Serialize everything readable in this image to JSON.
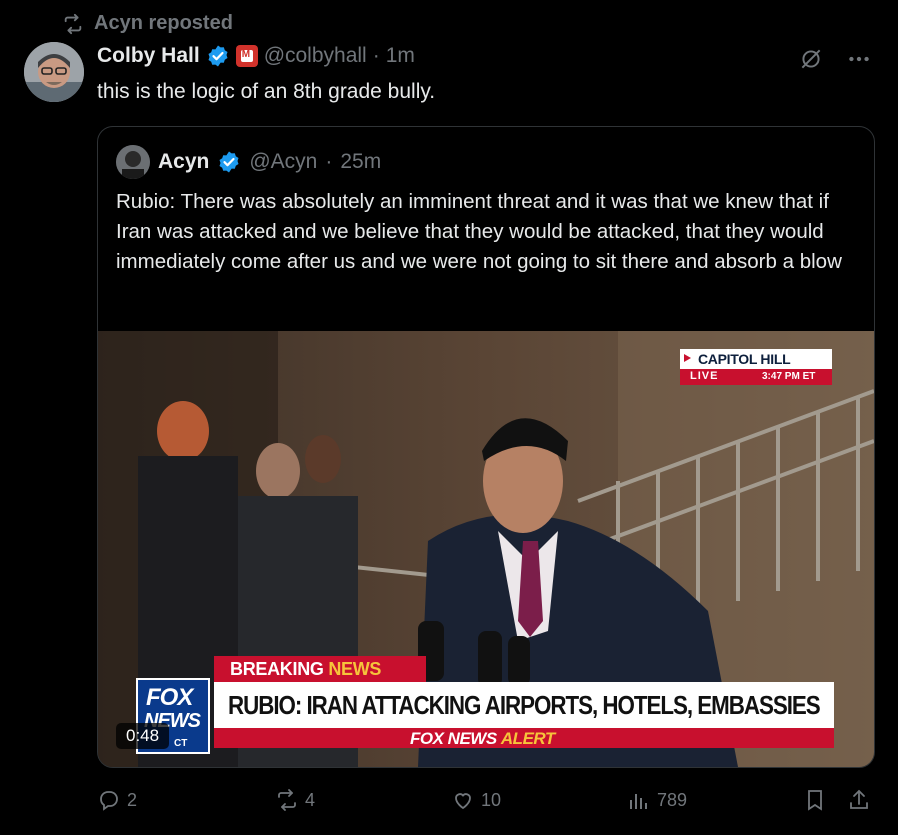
{
  "repost": {
    "label": "Acyn reposted",
    "icon": "repost-icon"
  },
  "tweet": {
    "author_name": "Colby Hall",
    "handle": "@colbyhall",
    "time": "1m",
    "text": "this is the logic of an 8th grade bully."
  },
  "quote": {
    "author_name": "Acyn",
    "handle": "@Acyn",
    "time": "25m",
    "text": "Rubio: There was absolutely an imminent threat and it was that we knew that if Iran was attacked and we believe that they would be attacked, that they would immediately come after us and we were not going to sit there and absorb a blow"
  },
  "video": {
    "bug_location": "CAPITOL HILL",
    "bug_live": "LIVE",
    "bug_time": "3:47 PM ET",
    "breaking_1": "BREAKING",
    "breaking_2": "NEWS",
    "headline": "RUBIO: IRAN ATTACKING AIRPORTS, HOTELS, EMBASSIES",
    "alert_1": "FOX NEWS",
    "alert_2": "ALERT",
    "logo_1": "FOX",
    "logo_2": "NEWS",
    "logo_3": "CT",
    "duration": "0:48"
  },
  "actions": {
    "replies": "2",
    "reposts": "4",
    "likes": "10",
    "views": "789"
  },
  "colors": {
    "accent": "#1d9bf0",
    "muted": "#71767b",
    "fox_red": "#c8102e"
  }
}
